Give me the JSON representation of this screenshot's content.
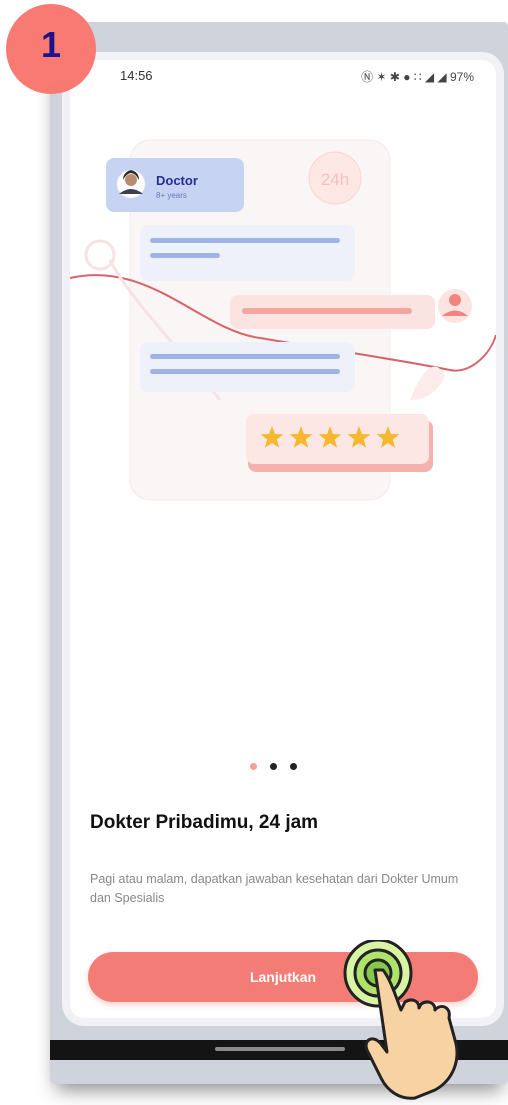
{
  "step": {
    "number": "1"
  },
  "status_bar": {
    "time": "14:56",
    "icons": "Ⓝ ✶ ✱ ● ∷ ◢ ◢",
    "battery": "97%"
  },
  "illustration": {
    "doctor_card": {
      "title": "Doctor",
      "subtitle": "8+ years"
    },
    "availability_badge": "24h",
    "rating_stars": 5
  },
  "pagination": {
    "total": 3,
    "active": 0
  },
  "onboarding": {
    "title": "Dokter Pribadimu, 24 jam",
    "description": "Pagi atau malam, dapatkan jawaban kesehatan dari Dokter Umum dan Spesialis",
    "cta_label": "Lanjutkan"
  },
  "colors": {
    "accent": "#f37d76",
    "badge": "#f87a73",
    "badge_text": "#1a148f",
    "star": "#f5b82e"
  }
}
